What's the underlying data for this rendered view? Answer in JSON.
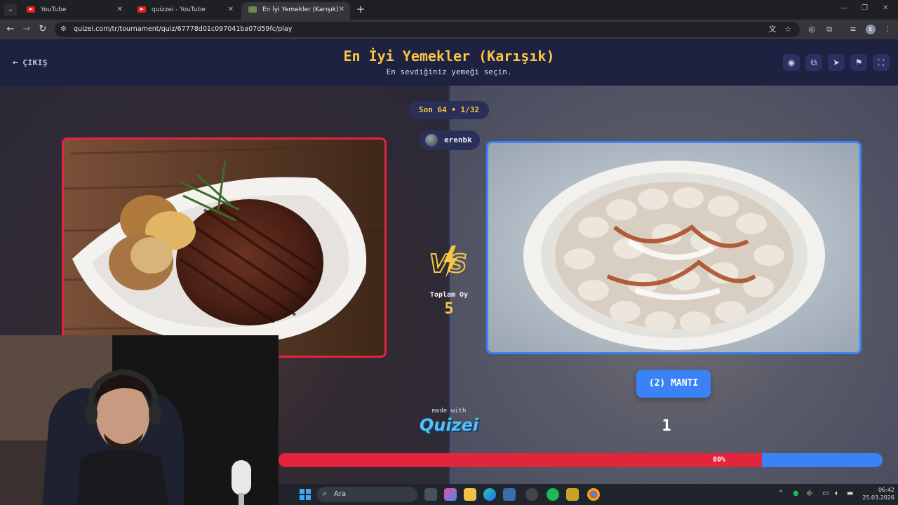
{
  "browser": {
    "tabs": [
      {
        "label": "YouTube",
        "close": "✕"
      },
      {
        "label": "quizzei - YouTube",
        "close": "✕"
      },
      {
        "label": "En İyi Yemekler (Karışık) - Tier Li",
        "close": "✕"
      }
    ],
    "new_tab": "+",
    "url": "quizei.com/tr/tournament/quiz/67778d01c097041ba07d59fc/play",
    "profile_initial": "E"
  },
  "header": {
    "exit_label": "ÇIKIŞ",
    "title": "En İyi Yemekler (Karışık)",
    "subtitle": "En sevdiğiniz yemeği seçin."
  },
  "round": {
    "label": "Son 64 • 1/32",
    "username": "erenbk"
  },
  "vote": {
    "label": "Toplam Oy",
    "total": "5"
  },
  "choices": {
    "right_button": "(2) MANTI",
    "right_count": "1"
  },
  "branding": {
    "made_with": "made with",
    "logo": "Quizei"
  },
  "progress": {
    "left_fraction": 0.8,
    "label": "80%"
  },
  "taskbar": {
    "search_placeholder": "Ara",
    "time": "06:42",
    "date": "25.03.2026"
  },
  "colors": {
    "accent_yellow": "#f6c744",
    "left_red": "#e3243d",
    "right_blue": "#3b82f6",
    "header_bg": "#1e2140"
  },
  "icons": [
    "back-icon",
    "forward-icon",
    "reload-icon",
    "translate-icon",
    "star-icon",
    "extensions-icon",
    "eye-icon",
    "copy-icon",
    "send-icon",
    "flag-icon",
    "fullscreen-icon",
    "search-icon",
    "windows-start-icon"
  ]
}
